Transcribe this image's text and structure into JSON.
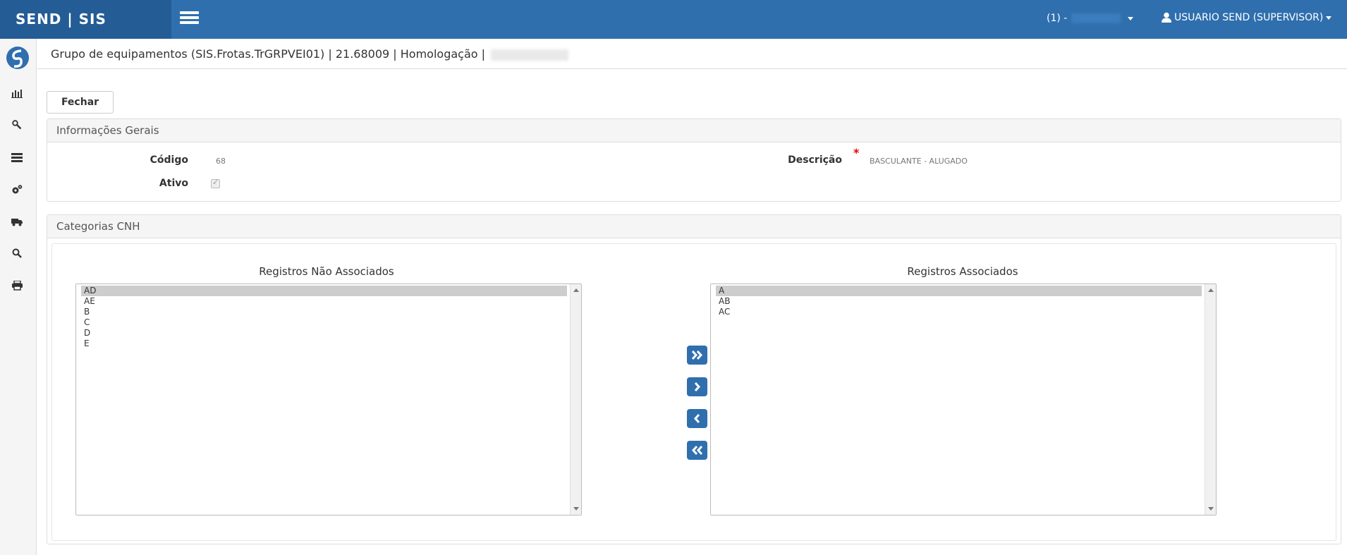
{
  "brand": "SEND | SIS",
  "company_selector": "(1) -",
  "user_menu": "USUARIO SEND (SUPERVISOR)",
  "page_title": "Grupo de equipamentos (SIS.Frotas.TrGRPVEI01) | 21.68009 | Homologação |",
  "close_button": "Fechar",
  "general_panel": {
    "title": "Informações Gerais",
    "codigo_label": "Código",
    "codigo_value": "68",
    "descricao_label": "Descrição",
    "descricao_required": "*",
    "descricao_value": "BASCULANTE - ALUGADO",
    "ativo_label": "Ativo",
    "ativo_checked": true
  },
  "cnh_panel": {
    "title": "Categorias CNH",
    "unassociated_title": "Registros Não Associados",
    "associated_title": "Registros Associados",
    "unassociated": [
      "AD",
      "AE",
      "B",
      "C",
      "D",
      "E"
    ],
    "associated": [
      "A",
      "AB",
      "AC"
    ]
  },
  "icons": {
    "sidebar": [
      "chart-icon",
      "wrench-icon",
      "list-icon",
      "cogs-icon",
      "truck-icon",
      "search-icon",
      "print-icon"
    ],
    "move_buttons": [
      "move-all-right-icon",
      "move-right-icon",
      "move-left-icon",
      "move-all-left-icon"
    ]
  },
  "colors": {
    "topbar": "#2f6fae",
    "brand_bg": "#245c96",
    "accent": "#2f6fae",
    "required": "#e00000"
  }
}
